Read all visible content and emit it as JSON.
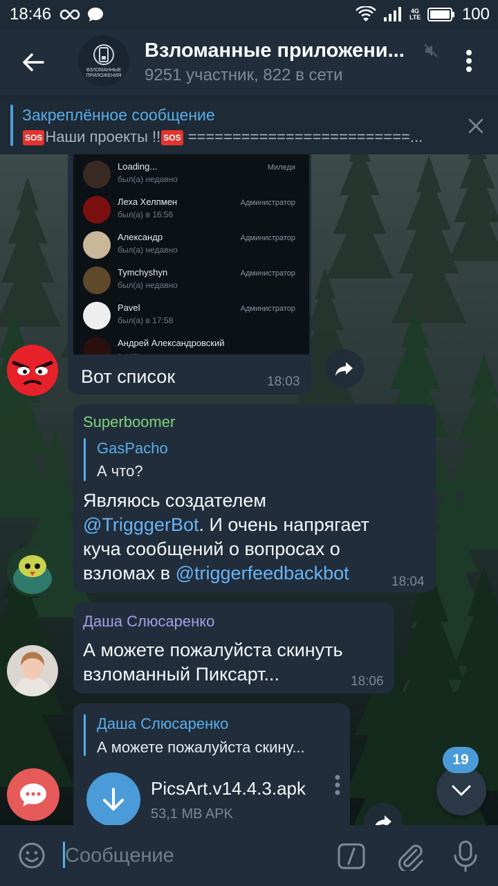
{
  "status_bar": {
    "time": "18:46",
    "battery": "100",
    "network": "4G LTE"
  },
  "header": {
    "title": "Взломанные приложени...",
    "subtitle": "9251 участник, 822 в сети",
    "avatar_text": "ВЗЛОМАННЫЕ ПРИЛОЖЕНИЯ"
  },
  "pinned": {
    "title": "Закреплённое сообщение",
    "text_prefix": "Наши проекты !!",
    "text_suffix": " =========================...",
    "sos": "SOS"
  },
  "screenshot_members": [
    {
      "name": "Loading...",
      "status": "был(а) недавно",
      "role": "Миледи",
      "color": "#3a2a24"
    },
    {
      "name": "Леха Хелпмен",
      "status": "был(а) в 16:56",
      "role": "Администратор",
      "color": "#7a1010"
    },
    {
      "name": "Александр",
      "status": "был(а) недавно",
      "role": "Администратор",
      "color": "#c9b79a"
    },
    {
      "name": "Tymchyshyn",
      "status": "был(а) недавно",
      "role": "Администратор",
      "color": "#5e4a2a"
    },
    {
      "name": "Pavel",
      "status": "был(а) в 17:58",
      "role": "Администратор",
      "color": "#eeeeee"
    },
    {
      "name": "Андрей Александровский",
      "status": "в сети",
      "role": "",
      "color": "#2a0f0f"
    }
  ],
  "messages": [
    {
      "text": "Вот список",
      "time": "18:03"
    },
    {
      "sender": "Superboomer",
      "reply_name": "GasPacho",
      "reply_text": "А что?",
      "line1": "Являюсь создателем",
      "line2_link": "@TrigggerBot",
      "line2_rest": ". И очень напрягает",
      "line3": "куча сообщений о вопросах о",
      "line4_pre": "взломах в ",
      "line4_link": "@triggerfeedbackbot",
      "time": "18:04"
    },
    {
      "sender": "Даша Слюсаренко",
      "line1": "А можете пожалуйста скинуть",
      "line2": "взломанный Пиксарт...",
      "time": "18:06"
    },
    {
      "reply_name": "Даша Слюсаренко",
      "reply_text": "А можете пожалуйста скину...",
      "file_name": "PicsArt.v14.4.3.apk",
      "file_meta": "53,1 MB APK"
    }
  ],
  "unread_count": "19",
  "input": {
    "placeholder": "Сообщение"
  },
  "colors": {
    "accent": "#5aaee8",
    "bubble": "#212d3b",
    "superboomer": "#7ed47a",
    "dasha": "#a69ee6"
  }
}
